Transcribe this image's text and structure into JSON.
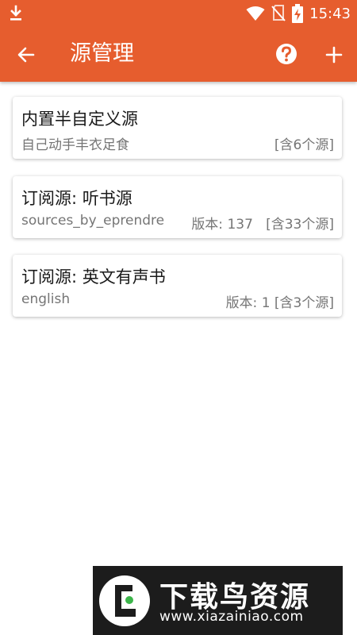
{
  "status_bar": {
    "time": "15:43",
    "icons": [
      "download-icon",
      "wifi-icon",
      "no-sim-icon",
      "battery-charging-icon"
    ]
  },
  "toolbar": {
    "title": "源管理",
    "back_icon": "arrow-left-icon",
    "help_icon": "help-circle-icon",
    "add_icon": "plus-icon"
  },
  "sources": [
    {
      "title": "内置半自定义源",
      "subtitle": "自己动手丰衣足食",
      "meta": "[含6个源]"
    },
    {
      "title": "订阅源: 听书源",
      "subtitle": "sources_by_eprendre",
      "meta": "版本: 137   [含33个源]"
    },
    {
      "title": "订阅源: 英文有声书",
      "subtitle": "english",
      "meta": "版本: 1 [含3个源]"
    }
  ],
  "watermark": {
    "name": "下载鸟资源",
    "url": "www.xiazainiao.com"
  },
  "colors": {
    "primary": "#e65d2e",
    "card_title": "#1a1a1a",
    "card_subtitle": "#757575",
    "watermark_bg": "#1c1c1c"
  }
}
